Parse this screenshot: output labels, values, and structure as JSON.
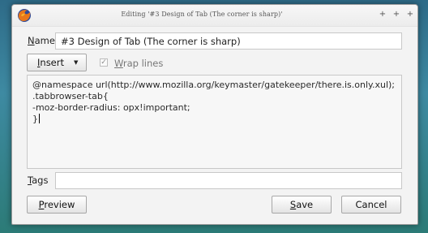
{
  "window": {
    "title": "Editing '#3 Design of Tab (The corner is sharp)'",
    "controls": [
      "+",
      "+",
      "+"
    ]
  },
  "form": {
    "name_label": "Name",
    "name_value": "#3 Design of Tab (The corner is sharp)",
    "insert_label": "Insert",
    "insert_arrow": "▼",
    "wrap_lines_label": "Wrap lines",
    "wrap_lines_checked": true,
    "wrap_lines_checkmark": "✓",
    "code_lines": [
      "@namespace url(http://www.mozilla.org/keymaster/gatekeeper/there.is.only.xul);",
      ".tabbrowser-tab{",
      "-moz-border-radius: opx!important;",
      "}"
    ],
    "tags_label": "Tags",
    "tags_value": ""
  },
  "buttons": {
    "preview": "Preview",
    "save": "Save",
    "cancel": "Cancel"
  },
  "colors": {
    "desktop": "#3e8aa2",
    "window_bg": "#f3f3f3",
    "field_bg": "#ffffff"
  },
  "icons": {
    "app": "firefox-icon",
    "dropdown": "chevron-down-icon",
    "checkbox": "checkmark-icon"
  }
}
